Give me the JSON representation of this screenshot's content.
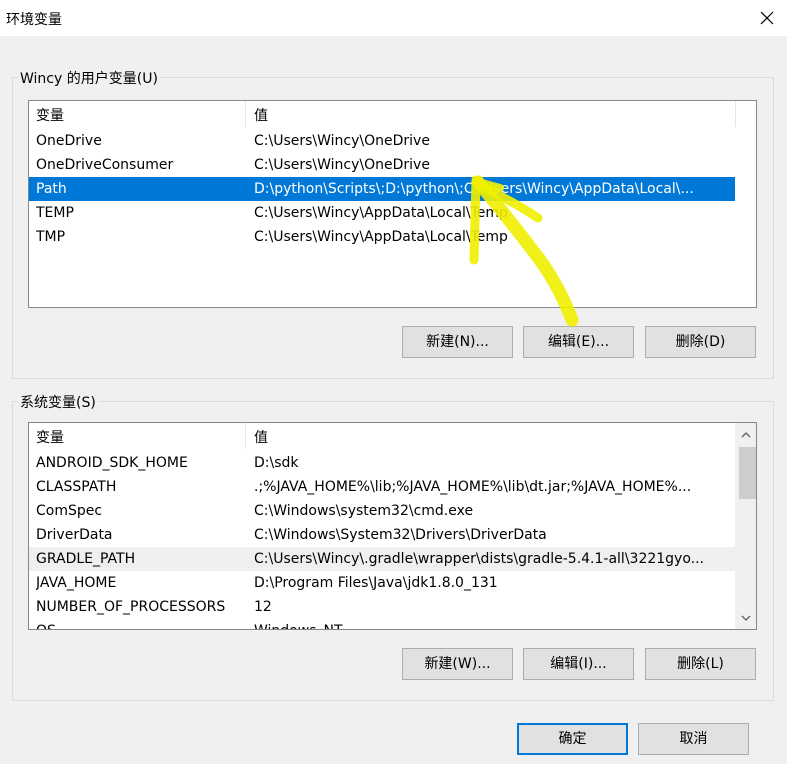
{
  "window": {
    "title": "环境变量",
    "close_glyph": "✕"
  },
  "user_vars": {
    "group_label": "Wincy 的用户变量(U)",
    "headers": {
      "name": "变量",
      "value": "值"
    },
    "rows": [
      {
        "name": "OneDrive",
        "value": "C:\\Users\\Wincy\\OneDrive"
      },
      {
        "name": "OneDriveConsumer",
        "value": "C:\\Users\\Wincy\\OneDrive"
      },
      {
        "name": "Path",
        "value": "D:\\python\\Scripts\\;D:\\python\\;C:\\Users\\Wincy\\AppData\\Local\\..."
      },
      {
        "name": "TEMP",
        "value": "C:\\Users\\Wincy\\AppData\\Local\\Temp"
      },
      {
        "name": "TMP",
        "value": "C:\\Users\\Wincy\\AppData\\Local\\Temp"
      }
    ],
    "selected_row": "Path",
    "buttons": {
      "new": "新建(N)...",
      "edit": "编辑(E)...",
      "delete": "删除(D)"
    }
  },
  "system_vars": {
    "group_label": "系统变量(S)",
    "headers": {
      "name": "变量",
      "value": "值"
    },
    "rows": [
      {
        "name": "ANDROID_SDK_HOME",
        "value": "D:\\sdk"
      },
      {
        "name": "CLASSPATH",
        "value": ".;%JAVA_HOME%\\lib;%JAVA_HOME%\\lib\\dt.jar;%JAVA_HOME%..."
      },
      {
        "name": "ComSpec",
        "value": "C:\\Windows\\system32\\cmd.exe"
      },
      {
        "name": "DriverData",
        "value": "C:\\Windows\\System32\\Drivers\\DriverData"
      },
      {
        "name": "GRADLE_PATH",
        "value": "C:\\Users\\Wincy\\.gradle\\wrapper\\dists\\gradle-5.4.1-all\\3221gyo..."
      },
      {
        "name": "JAVA_HOME",
        "value": "D:\\Program Files\\Java\\jdk1.8.0_131"
      },
      {
        "name": "NUMBER_OF_PROCESSORS",
        "value": "12"
      },
      {
        "name": "OS",
        "value": "Windows_NT"
      }
    ],
    "hover_row": "GRADLE_PATH",
    "buttons": {
      "new": "新建(W)...",
      "edit": "编辑(I)...",
      "delete": "删除(L)"
    }
  },
  "footer": {
    "ok": "确定",
    "cancel": "取消"
  },
  "icons": {
    "close": "close-icon",
    "scroll_up": "chevron-up-icon",
    "scroll_down": "chevron-down-icon",
    "annotation": "yellow-arrow-annotation"
  },
  "colors": {
    "selection": "#0078d7",
    "annotation": "#f0f000",
    "default_button_border": "#0078d7"
  }
}
